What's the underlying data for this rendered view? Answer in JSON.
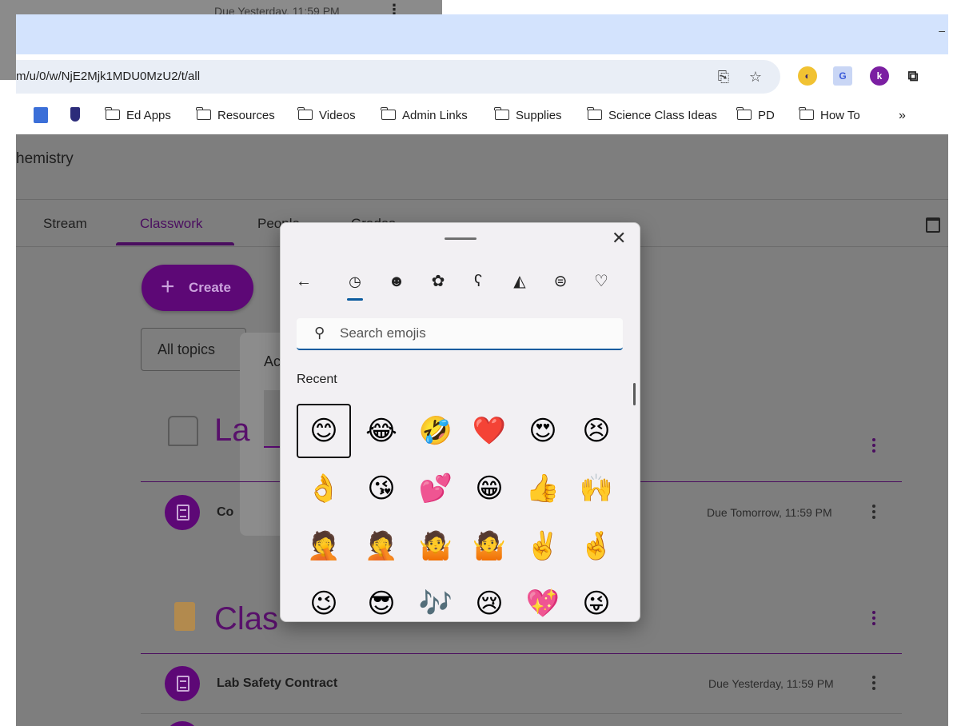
{
  "background_strip": {
    "due": "Due Yesterday, 11:59 PM"
  },
  "browser": {
    "url": "m/u/0/w/NjE2Mjk1MDU0MzU2/t/all",
    "bookmarks": [
      "Ed Apps",
      "Resources",
      "Videos",
      "Admin Links",
      "Supplies",
      "Science Class Ideas",
      "PD",
      "How To"
    ],
    "overflow": "»"
  },
  "classroom": {
    "class_name": "hemistry",
    "tabs": [
      "Stream",
      "Classwork",
      "People",
      "Grades"
    ],
    "active_tab": "Classwork",
    "create_label": "Create",
    "topics_filter": "All topics",
    "behind_dialog_text": "Ac",
    "topics": [
      {
        "title": "La",
        "item": {
          "title": "Co",
          "due": "Due Tomorrow, 11:59 PM"
        }
      },
      {
        "title": "Clas",
        "item": {
          "title": "Lab Safety Contract",
          "due": "Due Yesterday, 11:59 PM"
        }
      }
    ]
  },
  "emoji_panel": {
    "search_placeholder": "Search emojis",
    "section_label": "Recent",
    "close": "✕",
    "back": "←",
    "category_icons": [
      "clock-icon",
      "smiley-icon",
      "sticker-icon",
      "kaomoji-icon",
      "symbols-icon",
      "car-icon",
      "heart-icon"
    ],
    "emojis": [
      [
        "😊",
        "😂",
        "🤣",
        "❤️",
        "😍",
        "😣"
      ],
      [
        "👌",
        "😘",
        "💕",
        "😁",
        "👍",
        "🙌"
      ],
      [
        "🤦",
        "🤦",
        "🤷",
        "🤷",
        "✌️",
        "🤞"
      ],
      [
        "😉",
        "😎",
        "🎶",
        "😢",
        "💖",
        "😜"
      ]
    ]
  }
}
